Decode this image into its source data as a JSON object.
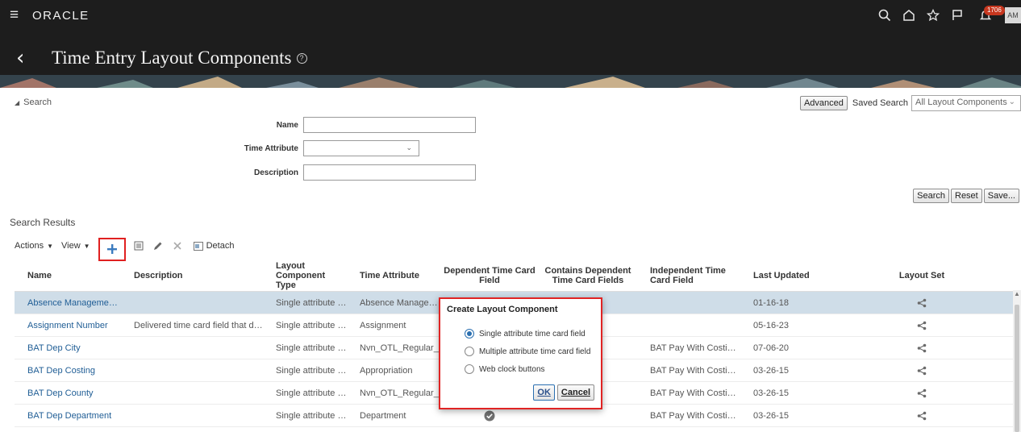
{
  "app": {
    "brand": "ORACLE",
    "notification_count": "1706",
    "avatar_initials": "AM"
  },
  "page": {
    "title": "Time Entry Layout Components"
  },
  "search": {
    "toggle_label": "Search",
    "fields": {
      "name_label": "Name",
      "time_attribute_label": "Time Attribute",
      "description_label": "Description"
    },
    "advanced_label": "Advanced",
    "saved_search_label": "Saved Search",
    "saved_search_value": "All Layout Components",
    "buttons": {
      "search": "Search",
      "reset": "Reset",
      "save": "Save..."
    }
  },
  "results": {
    "title": "Search Results",
    "toolbar": {
      "actions": "Actions",
      "view": "View",
      "detach": "Detach"
    },
    "columns": [
      "Name",
      "Description",
      "Layout Component Type",
      "Time Attribute",
      "Dependent Time Card Field",
      "Contains Dependent Time Card Fields",
      "Independent Time Card Field",
      "Last Updated",
      "Layout Set"
    ],
    "rows": [
      {
        "name": "Absence Management t...",
        "description": "",
        "type": "Single attribute ti...",
        "attribute": "Absence Managem...",
        "independent": "",
        "updated": "01-16-18"
      },
      {
        "name": "Assignment Number",
        "description": "Delivered time card field that dis...",
        "type": "Single attribute ti...",
        "attribute": "Assignment",
        "independent": "",
        "updated": "05-16-23"
      },
      {
        "name": "BAT Dep City",
        "description": "",
        "type": "Single attribute ti...",
        "attribute": "Nvn_OTL_Regular_",
        "independent": "BAT Pay With Costing ...",
        "updated": "07-06-20"
      },
      {
        "name": "BAT Dep Costing",
        "description": "",
        "type": "Single attribute ti...",
        "attribute": "Appropriation",
        "independent": "BAT Pay With Costing ...",
        "updated": "03-26-15"
      },
      {
        "name": "BAT Dep County",
        "description": "",
        "type": "Single attribute ti...",
        "attribute": "Nvn_OTL_Regular_",
        "independent": "BAT Pay With Costing ...",
        "updated": "03-26-15"
      },
      {
        "name": "BAT Dep Department",
        "description": "",
        "type": "Single attribute ti...",
        "attribute": "Department",
        "independent": "BAT Pay With Costing ...",
        "updated": "03-26-15"
      }
    ]
  },
  "dialog": {
    "title": "Create Layout Component",
    "options": [
      "Single attribute time card field",
      "Multiple attribute time card field",
      "Web clock buttons"
    ],
    "selected_option": "Single attribute time card field",
    "ok_label": "OK",
    "cancel_label": "Cancel"
  },
  "colors": {
    "header_bg": "#1d1d1d",
    "link": "#1f5d95",
    "selected_row": "#cfdde8",
    "highlight_box": "#e02020"
  }
}
